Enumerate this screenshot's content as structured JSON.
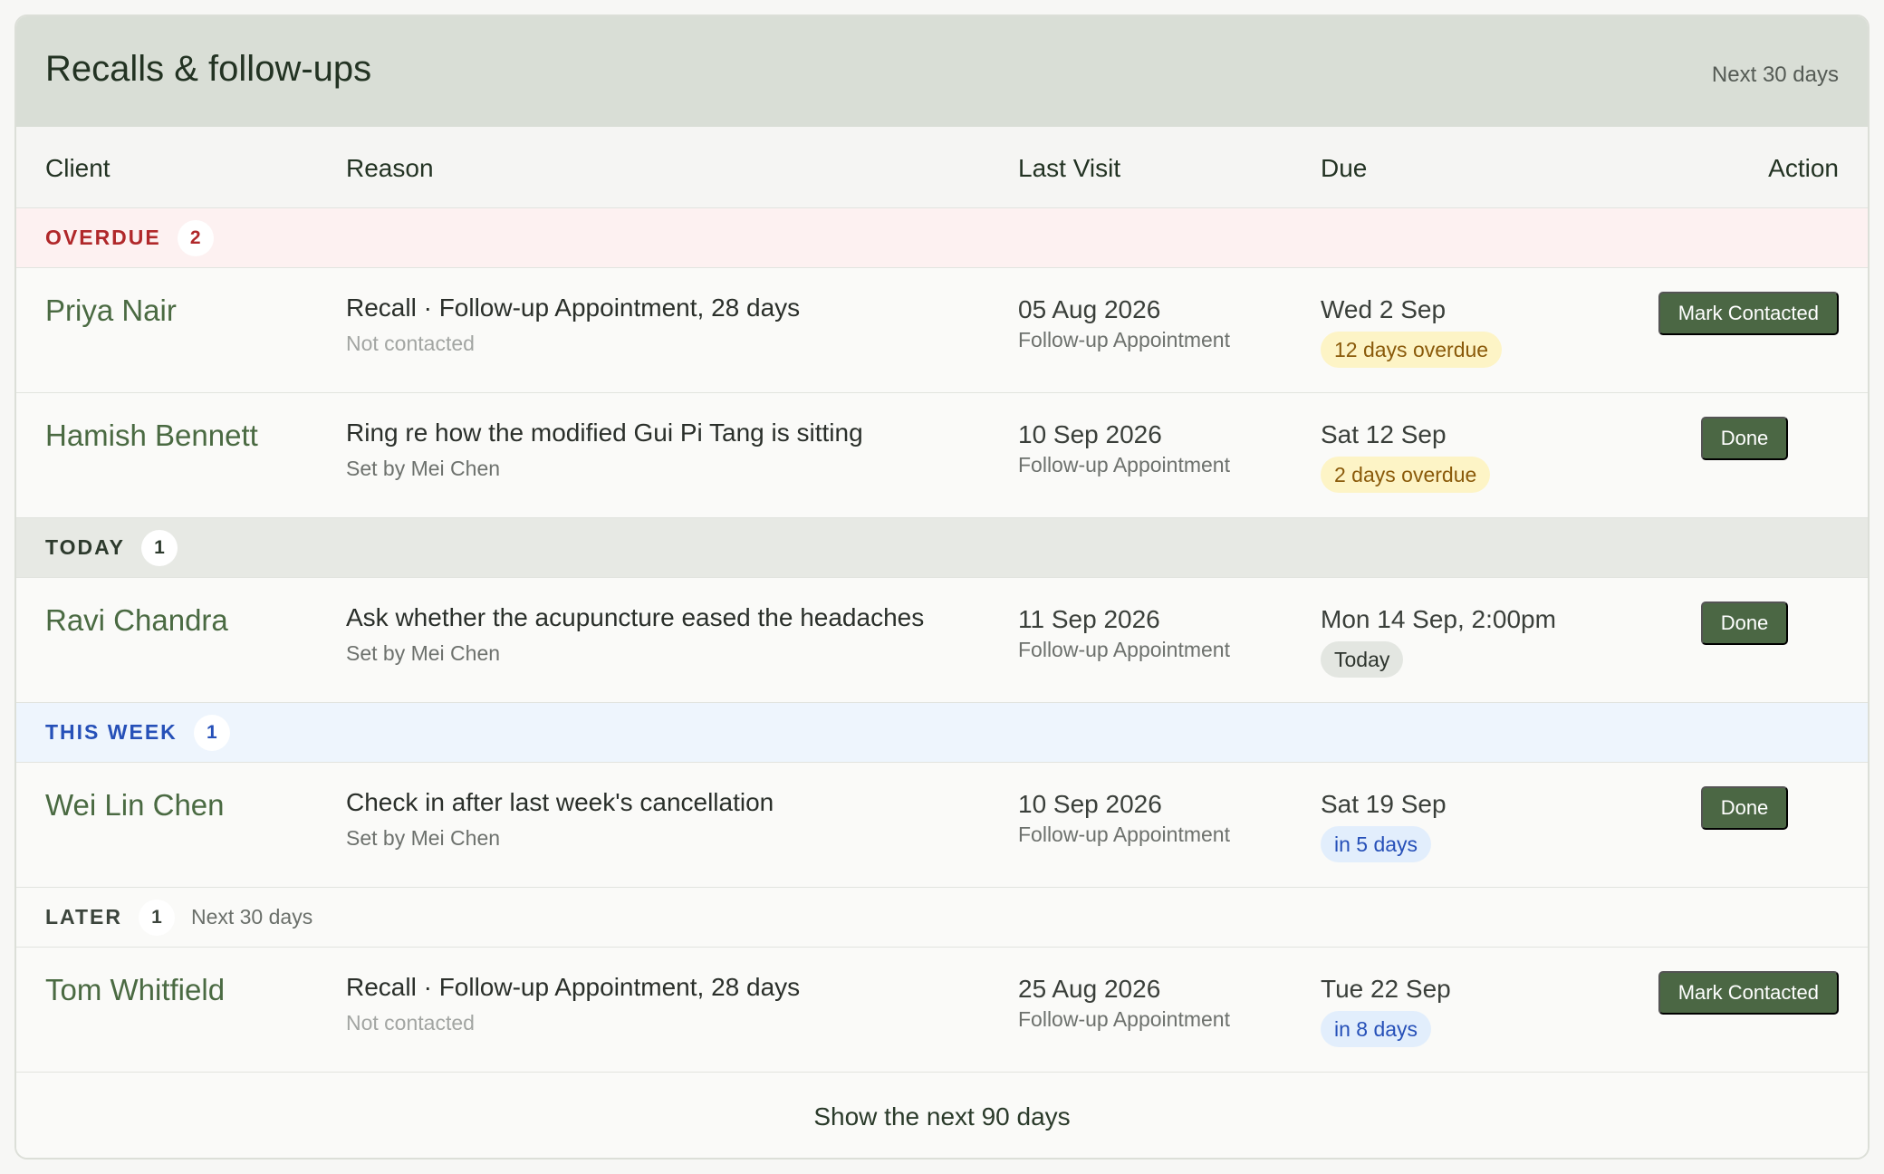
{
  "header": {
    "title": "Recalls & follow-ups",
    "range": "Next 30 days"
  },
  "columns": {
    "client": "Client",
    "reason": "Reason",
    "last_visit": "Last Visit",
    "due": "Due",
    "action": "Action"
  },
  "groups": {
    "overdue": {
      "label": "OVERDUE",
      "count": "2",
      "rows": [
        {
          "client": "Priya Nair",
          "reason": "Recall · Follow-up Appointment, 28 days",
          "reason_sub": "Not contacted",
          "last_visit": "05 Aug 2026",
          "last_visit_sub": "Follow-up Appointment",
          "due": "Wed 2 Sep",
          "due_pill": "12 days overdue",
          "action": "Mark Contacted"
        },
        {
          "client": "Hamish Bennett",
          "reason": "Ring re how the modified Gui Pi Tang is sitting",
          "reason_sub": "Set by Mei Chen",
          "last_visit": "10 Sep 2026",
          "last_visit_sub": "Follow-up Appointment",
          "due": "Sat 12 Sep",
          "due_pill": "2 days overdue",
          "action": "Done"
        }
      ]
    },
    "today": {
      "label": "TODAY",
      "count": "1",
      "rows": [
        {
          "client": "Ravi Chandra",
          "reason": "Ask whether the acupuncture eased the headaches",
          "reason_sub": "Set by Mei Chen",
          "last_visit": "11 Sep 2026",
          "last_visit_sub": "Follow-up Appointment",
          "due": "Mon 14 Sep, 2:00pm",
          "due_pill": "Today",
          "action": "Done"
        }
      ]
    },
    "this_week": {
      "label": "THIS WEEK",
      "count": "1",
      "rows": [
        {
          "client": "Wei Lin Chen",
          "reason": "Check in after last week's cancellation",
          "reason_sub": "Set by Mei Chen",
          "last_visit": "10 Sep 2026",
          "last_visit_sub": "Follow-up Appointment",
          "due": "Sat 19 Sep",
          "due_pill": "in 5 days",
          "action": "Done"
        }
      ]
    },
    "later": {
      "label": "LATER",
      "count": "1",
      "note": "Next 30 days",
      "rows": [
        {
          "client": "Tom Whitfield",
          "reason": "Recall · Follow-up Appointment, 28 days",
          "reason_sub": "Not contacted",
          "last_visit": "25 Aug 2026",
          "last_visit_sub": "Follow-up Appointment",
          "due": "Tue 22 Sep",
          "due_pill": "in 8 days",
          "action": "Mark Contacted"
        }
      ]
    }
  },
  "footer": {
    "show_more": "Show the next 90 days"
  },
  "colors": {
    "header_bg": "#d9ded6",
    "accent_green": "#4b6744",
    "overdue_red": "#b0282a",
    "week_blue": "#2650b8",
    "overdue_pill_bg": "#fdf4c6",
    "soon_pill_bg": "#e2eefc"
  }
}
